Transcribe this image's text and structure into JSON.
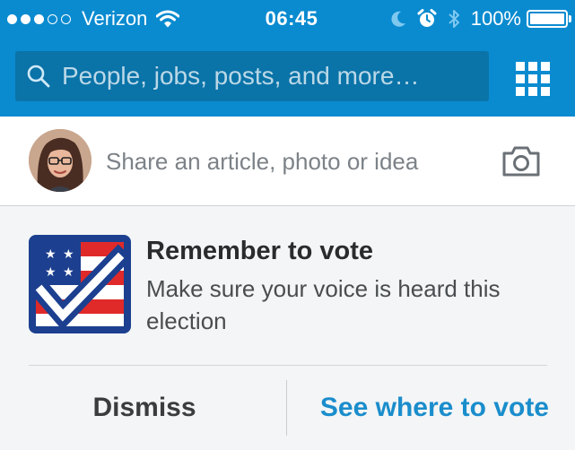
{
  "status_bar": {
    "signal_strength": 3,
    "signal_total": 5,
    "carrier": "Verizon",
    "time": "06:45",
    "battery_percent": "100%",
    "battery_level": 1.0,
    "icons": [
      "wifi-icon",
      "moon-icon",
      "alarm-icon",
      "bluetooth-icon",
      "battery-icon"
    ]
  },
  "header": {
    "search_placeholder": "People, jobs, posts, and more…",
    "icons": [
      "search-icon",
      "apps-grid-icon"
    ]
  },
  "share": {
    "prompt": "Share an article, photo or idea",
    "icons": [
      "avatar",
      "camera-icon"
    ]
  },
  "vote_card": {
    "title": "Remember to vote",
    "message": "Make sure your voice is heard this election",
    "dismiss_label": "Dismiss",
    "action_label": "See where to vote",
    "icon": "vote-flag-checkmark-icon"
  },
  "colors": {
    "header_blue": "#0a8bd0",
    "search_field": "#0a73a8",
    "link_blue": "#1a8dcc",
    "card_background": "#f3f5f6",
    "flag_blue": "#1c3f8f",
    "flag_red": "#e02a2a"
  }
}
